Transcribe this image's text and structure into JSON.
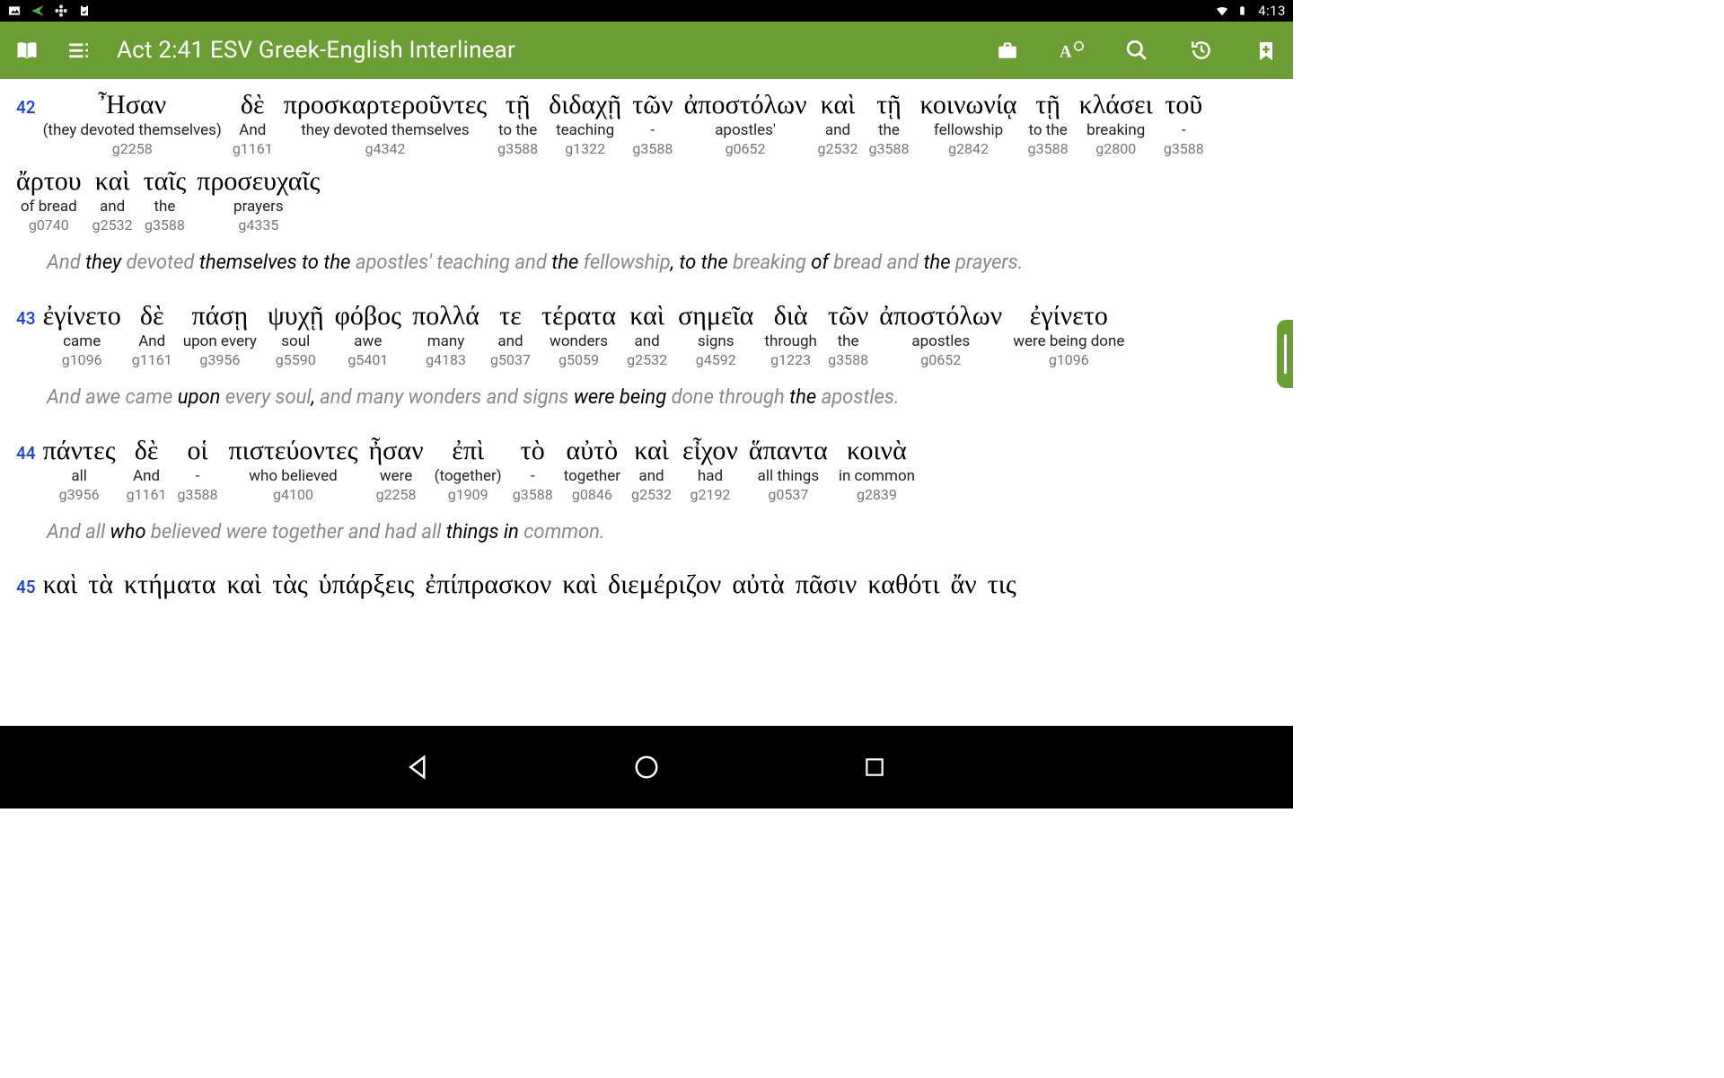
{
  "status": {
    "time": "4:13"
  },
  "appbar": {
    "title": "Act 2:41 ESV Greek-English Interlinear"
  },
  "verses": [
    {
      "num": "42",
      "words": [
        {
          "greek": "Ἦσαν",
          "gloss": "(they devoted themselves)",
          "strongs": "g2258"
        },
        {
          "greek": "δὲ",
          "gloss": "And",
          "strongs": "g1161"
        },
        {
          "greek": "προσκαρτεροῦντες",
          "gloss": "they devoted themselves",
          "strongs": "g4342"
        },
        {
          "greek": "τῇ",
          "gloss": "to the",
          "strongs": "g3588"
        },
        {
          "greek": "διδαχῇ",
          "gloss": "teaching",
          "strongs": "g1322"
        },
        {
          "greek": "τῶν",
          "gloss": "-",
          "strongs": "g3588"
        },
        {
          "greek": "ἀποστόλων",
          "gloss": "apostles'",
          "strongs": "g0652"
        },
        {
          "greek": "καὶ",
          "gloss": "and",
          "strongs": "g2532"
        },
        {
          "greek": "τῇ",
          "gloss": "the",
          "strongs": "g3588"
        },
        {
          "greek": "κοινωνίᾳ",
          "gloss": "fellowship",
          "strongs": "g2842"
        },
        {
          "greek": "τῇ",
          "gloss": "to the",
          "strongs": "g3588"
        },
        {
          "greek": "κλάσει",
          "gloss": "breaking",
          "strongs": "g2800"
        },
        {
          "greek": "τοῦ",
          "gloss": "-",
          "strongs": "g3588"
        },
        {
          "greek": "ἄρτου",
          "gloss": "of bread",
          "strongs": "g0740"
        },
        {
          "greek": "καὶ",
          "gloss": "and",
          "strongs": "g2532"
        },
        {
          "greek": "ταῖς",
          "gloss": "the",
          "strongs": "g3588"
        },
        {
          "greek": "προσευχαῖς",
          "gloss": "prayers",
          "strongs": "g4335"
        }
      ],
      "translation": [
        {
          "t": "And ",
          "em": false
        },
        {
          "t": "they",
          "em": true
        },
        {
          "t": " devoted ",
          "em": false
        },
        {
          "t": "themselves to the",
          "em": true
        },
        {
          "t": " apostles' teaching and ",
          "em": false
        },
        {
          "t": "the",
          "em": true
        },
        {
          "t": " fellowship",
          "em": false
        },
        {
          "t": ", to the",
          "em": true
        },
        {
          "t": " breaking ",
          "em": false
        },
        {
          "t": "of",
          "em": true
        },
        {
          "t": " bread and ",
          "em": false
        },
        {
          "t": "the",
          "em": true
        },
        {
          "t": " prayers.",
          "em": false
        }
      ]
    },
    {
      "num": "43",
      "words": [
        {
          "greek": "ἐγίνετο",
          "gloss": "came",
          "strongs": "g1096"
        },
        {
          "greek": "δὲ",
          "gloss": "And",
          "strongs": "g1161"
        },
        {
          "greek": "πάσῃ",
          "gloss": "upon every",
          "strongs": "g3956"
        },
        {
          "greek": "ψυχῇ",
          "gloss": "soul",
          "strongs": "g5590"
        },
        {
          "greek": "φόβος",
          "gloss": "awe",
          "strongs": "g5401"
        },
        {
          "greek": "πολλά",
          "gloss": "many",
          "strongs": "g4183"
        },
        {
          "greek": "τε",
          "gloss": "and",
          "strongs": "g5037"
        },
        {
          "greek": "τέρατα",
          "gloss": "wonders",
          "strongs": "g5059"
        },
        {
          "greek": "καὶ",
          "gloss": "and",
          "strongs": "g2532"
        },
        {
          "greek": "σημεῖα",
          "gloss": "signs",
          "strongs": "g4592"
        },
        {
          "greek": "διὰ",
          "gloss": "through",
          "strongs": "g1223"
        },
        {
          "greek": "τῶν",
          "gloss": "the",
          "strongs": "g3588"
        },
        {
          "greek": "ἀποστόλων",
          "gloss": "apostles",
          "strongs": "g0652"
        },
        {
          "greek": "ἐγίνετο",
          "gloss": "were being done",
          "strongs": "g1096"
        }
      ],
      "translation": [
        {
          "t": "And awe came ",
          "em": false
        },
        {
          "t": "upon",
          "em": true
        },
        {
          "t": " every soul",
          "em": false
        },
        {
          "t": ",",
          "em": true
        },
        {
          "t": " and many wonders and signs ",
          "em": false
        },
        {
          "t": "were being",
          "em": true
        },
        {
          "t": " done through ",
          "em": false
        },
        {
          "t": "the",
          "em": true
        },
        {
          "t": " apostles.",
          "em": false
        }
      ]
    },
    {
      "num": "44",
      "words": [
        {
          "greek": "πάντες",
          "gloss": "all",
          "strongs": "g3956"
        },
        {
          "greek": "δὲ",
          "gloss": "And",
          "strongs": "g1161"
        },
        {
          "greek": "οἱ",
          "gloss": "-",
          "strongs": "g3588"
        },
        {
          "greek": "πιστεύοντες",
          "gloss": "who believed",
          "strongs": "g4100"
        },
        {
          "greek": "ἦσαν",
          "gloss": "were",
          "strongs": "g2258"
        },
        {
          "greek": "ἐπὶ",
          "gloss": "(together)",
          "strongs": "g1909"
        },
        {
          "greek": "τὸ",
          "gloss": "-",
          "strongs": "g3588"
        },
        {
          "greek": "αὐτὸ",
          "gloss": "together",
          "strongs": "g0846"
        },
        {
          "greek": "καὶ",
          "gloss": "and",
          "strongs": "g2532"
        },
        {
          "greek": "εἶχον",
          "gloss": "had",
          "strongs": "g2192"
        },
        {
          "greek": "ἅπαντα",
          "gloss": "all things",
          "strongs": "g0537"
        },
        {
          "greek": "κοινὰ",
          "gloss": "in common",
          "strongs": "g2839"
        }
      ],
      "translation": [
        {
          "t": "And all ",
          "em": false
        },
        {
          "t": "who",
          "em": true
        },
        {
          "t": " believed were together and had all ",
          "em": false
        },
        {
          "t": "things in",
          "em": true
        },
        {
          "t": " common.",
          "em": false
        }
      ]
    },
    {
      "num": "45",
      "words": [
        {
          "greek": "καὶ",
          "gloss": "",
          "strongs": ""
        },
        {
          "greek": "τὰ",
          "gloss": "",
          "strongs": ""
        },
        {
          "greek": "κτήματα",
          "gloss": "",
          "strongs": ""
        },
        {
          "greek": "καὶ",
          "gloss": "",
          "strongs": ""
        },
        {
          "greek": "τὰς",
          "gloss": "",
          "strongs": ""
        },
        {
          "greek": "ὑπάρξεις",
          "gloss": "",
          "strongs": ""
        },
        {
          "greek": "ἐπίπρασκον",
          "gloss": "",
          "strongs": ""
        },
        {
          "greek": "καὶ",
          "gloss": "",
          "strongs": ""
        },
        {
          "greek": "διεμέριζον",
          "gloss": "",
          "strongs": ""
        },
        {
          "greek": "αὐτὰ",
          "gloss": "",
          "strongs": ""
        },
        {
          "greek": "πᾶσιν",
          "gloss": "",
          "strongs": ""
        },
        {
          "greek": "καθότι",
          "gloss": "",
          "strongs": ""
        },
        {
          "greek": "ἄν",
          "gloss": "",
          "strongs": ""
        },
        {
          "greek": "τις",
          "gloss": "",
          "strongs": ""
        }
      ],
      "translation": []
    }
  ]
}
